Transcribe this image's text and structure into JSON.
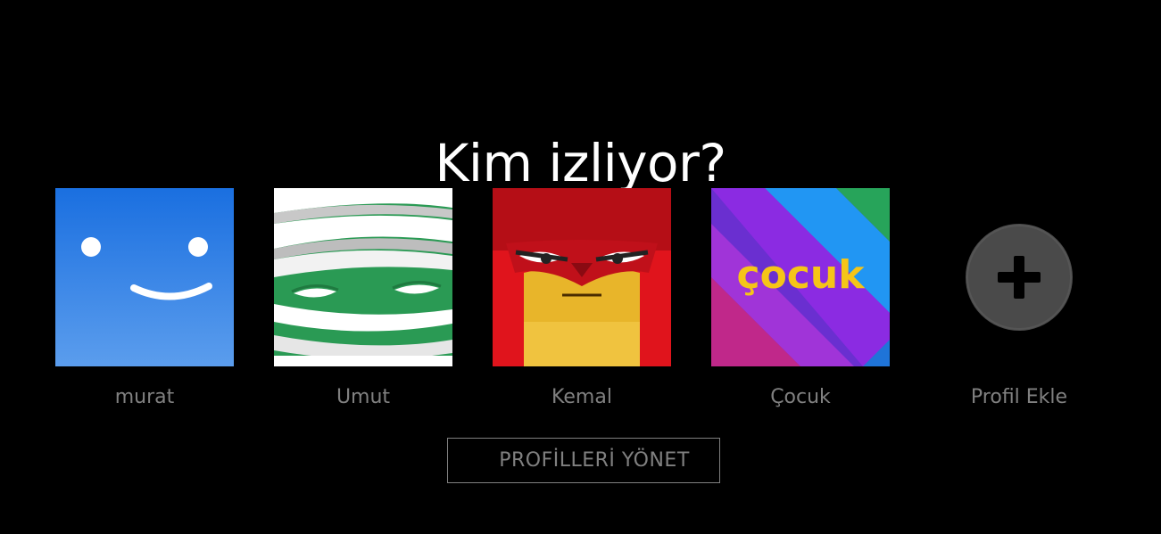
{
  "heading": "Kim izliyor?",
  "profiles": [
    {
      "name": "murat",
      "icon": "smiley-face-avatar",
      "color": "#2f78e4"
    },
    {
      "name": "Umut",
      "icon": "mummy-avatar",
      "color": "#2a9a54"
    },
    {
      "name": "Kemal",
      "icon": "masked-hero-avatar",
      "color": "#d9121c"
    },
    {
      "name": "Çocuk",
      "icon": "kids-avatar",
      "color": "#7b2fd6",
      "logo_text": "çocuk"
    },
    {
      "name": "Profil Ekle",
      "icon": "plus-icon",
      "color": "#4a4a4a"
    }
  ],
  "manage_button": "PROFİLLERİ YÖNET"
}
